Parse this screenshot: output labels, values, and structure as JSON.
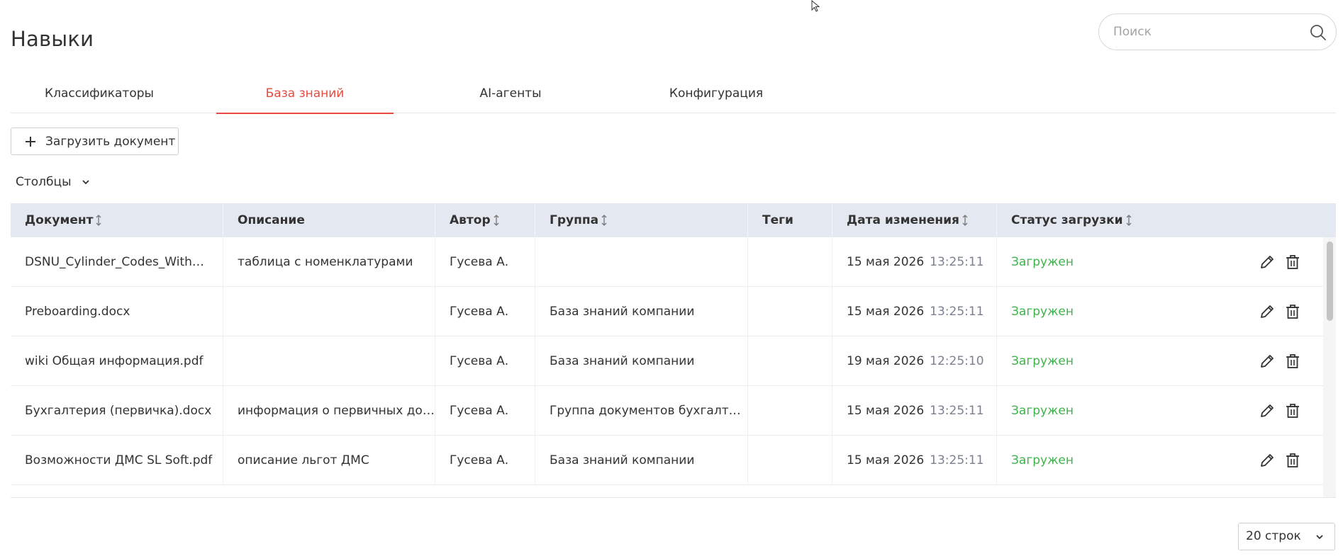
{
  "page": {
    "title": "Навыки"
  },
  "search": {
    "placeholder": "Поиск"
  },
  "tabs": [
    {
      "label": "Классификаторы",
      "active": false
    },
    {
      "label": "База знаний",
      "active": true
    },
    {
      "label": "AI-агенты",
      "active": false
    },
    {
      "label": "Конфигурация",
      "active": false
    }
  ],
  "toolbar": {
    "upload_label": "Загрузить документ",
    "columns_label": "Столбцы"
  },
  "table": {
    "headers": {
      "document": "Документ",
      "description": "Описание",
      "author": "Автор",
      "group": "Группа",
      "tags": "Теги",
      "modified": "Дата изменения",
      "status": "Статус загрузки"
    },
    "rows": [
      {
        "document": "DSNU_Cylinder_Codes_With…",
        "description": "таблица с номенклатурами",
        "author": "Гусева А.",
        "group": "",
        "tags": "",
        "date": "15 мая 2026",
        "time": "13:25:11",
        "status": "Загружен"
      },
      {
        "document": "Preboarding.docx",
        "description": "",
        "author": "Гусева А.",
        "group": "База знаний компании",
        "tags": "",
        "date": "15 мая 2026",
        "time": "13:25:11",
        "status": "Загружен"
      },
      {
        "document": "wiki Общая информация.pdf",
        "description": "",
        "author": "Гусева А.",
        "group": "База знаний компании",
        "tags": "",
        "date": "19 мая 2026",
        "time": "12:25:10",
        "status": "Загружен"
      },
      {
        "document": "Бухгалтерия (первичка).docx",
        "description": "информация о первичных до…",
        "author": "Гусева А.",
        "group": "Группа документов бухгалте…",
        "tags": "",
        "date": "15 мая 2026",
        "time": "13:25:11",
        "status": "Загружен"
      },
      {
        "document": "Возможности ДМС SL Soft.pdf",
        "description": "описание льгот ДМС",
        "author": "Гусева А.",
        "group": "База знаний компании",
        "tags": "",
        "date": "15 мая 2026",
        "time": "13:25:11",
        "status": "Загружен"
      }
    ]
  },
  "pagination": {
    "rows_label": "20 строк"
  },
  "colors": {
    "accent": "#e84a3e",
    "status_ok": "#3db34a",
    "header_bg": "#e3e8f1"
  },
  "icons": [
    "search-icon",
    "plus-icon",
    "chevron-down-icon",
    "sort-icon",
    "edit-icon",
    "trash-icon",
    "mouse-cursor-icon"
  ]
}
